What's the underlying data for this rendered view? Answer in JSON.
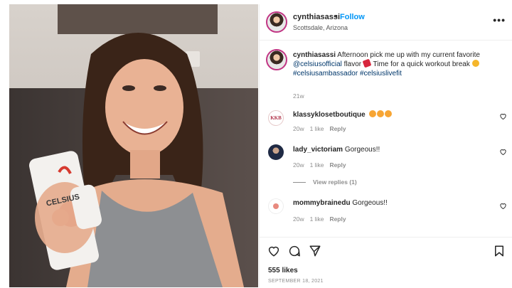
{
  "post": {
    "author": "cynthiasassi",
    "separator": "•",
    "follow_label": "Follow",
    "location": "Scottsdale, Arizona",
    "more_label": "•••"
  },
  "photo": {
    "can_brand": "CELSIUS"
  },
  "caption": {
    "username": "cynthiasassi",
    "text_1": " Afternoon pick me up with my current favorite ",
    "mention": "@celsiusofficial",
    "text_2": " flavor ",
    "text_3": " Time for a quick workout break ",
    "hashtag_1": "#celsiusambassador",
    "hashtag_2": " #celsiuslivefit",
    "age": "21w"
  },
  "comments": [
    {
      "username": "klassyklosetboutique",
      "text": "",
      "age": "20w",
      "likes": "1 like",
      "reply": "Reply",
      "avatar_text": "KKB"
    },
    {
      "username": "lady_victoriam",
      "text": " Gorgeous!!",
      "age": "20w",
      "likes": "1 like",
      "reply": "Reply",
      "view_replies": "View replies (1)"
    },
    {
      "username": "mommybrainedu",
      "text": " Gorgeous!!",
      "age": "20w",
      "likes": "1 like",
      "reply": "Reply"
    }
  ],
  "footer": {
    "likes": "555 likes",
    "date": "SEPTEMBER 18, 2021"
  },
  "colors": {
    "link": "#00376b",
    "follow": "#0095f6",
    "muted": "#8e8e8e"
  },
  "icons": [
    "heart-icon",
    "comment-icon",
    "share-icon",
    "bookmark-icon",
    "more-icon"
  ]
}
